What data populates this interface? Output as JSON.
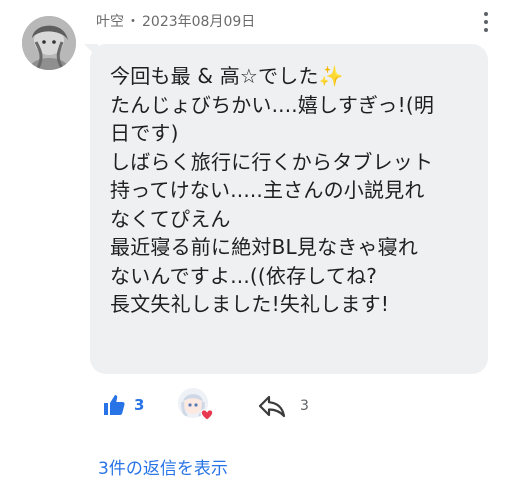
{
  "comment": {
    "author": "叶空",
    "separator": "・",
    "date": "2023年08月09日",
    "message_lines": [
      "今回も最 & 高☆でした✨",
      "たんじょびちかい....嬉しすぎっ!(明",
      "日です)",
      "しばらく旅行に行くからタブレット",
      "持ってけない.....主さんの小説見れ",
      "なくてぴえん",
      "最近寝る前に絶対BL見なきゃ寝れ",
      "ないんですよ...((依存してね?",
      "長文失礼しました!失礼します!"
    ],
    "likes": "3",
    "replies_count": "3",
    "view_replies_label": "3件の返信を表示"
  },
  "colors": {
    "accent": "#2874e6",
    "bubble": "#eff0f2",
    "heart": "#e8384f"
  },
  "icons": {
    "like": "thumbs-up-icon",
    "reply": "reply-arrow-icon",
    "more": "more-vertical-icon",
    "reaction": "heart-icon"
  }
}
